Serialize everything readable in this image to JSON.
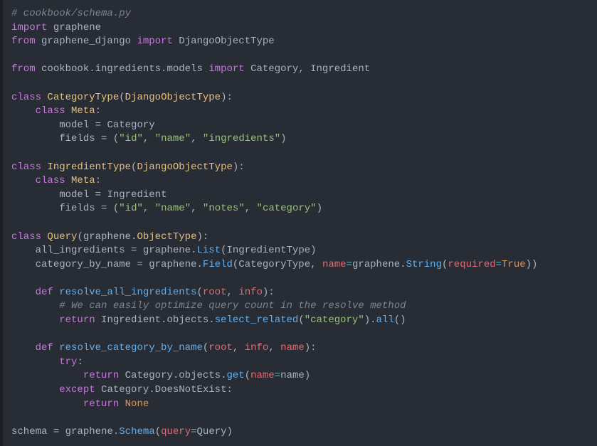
{
  "code": {
    "l1_comment": "# cookbook/schema.py",
    "l2_import": "import",
    "l2_graphene": "graphene",
    "l3_from": "from",
    "l3_mod": "graphene_django",
    "l3_import": "import",
    "l3_type": "DjangoObjectType",
    "l4_from": "from",
    "l4_mod": "cookbook.ingredients.models",
    "l4_import": "import",
    "l4_cat": "Category",
    "l4_comma": ",",
    "l4_ing": "Ingredient",
    "l5_class": "class",
    "l5_name": "CategoryType",
    "l5_open": "(",
    "l5_base": "DjangoObjectType",
    "l5_close": "):",
    "l6_class": "class",
    "l6_meta": "Meta",
    "l6_colon": ":",
    "l7_model": "model",
    "l7_eq": " = ",
    "l7_val": "Category",
    "l8_fields": "fields",
    "l8_eq": " = ",
    "l8_open": "(",
    "l8_s1": "\"id\"",
    "l8_c1": ", ",
    "l8_s2": "\"name\"",
    "l8_c2": ", ",
    "l8_s3": "\"ingredients\"",
    "l8_close": ")",
    "l9_class": "class",
    "l9_name": "IngredientType",
    "l9_open": "(",
    "l9_base": "DjangoObjectType",
    "l9_close": "):",
    "l10_class": "class",
    "l10_meta": "Meta",
    "l10_colon": ":",
    "l11_model": "model",
    "l11_eq": " = ",
    "l11_val": "Ingredient",
    "l12_fields": "fields",
    "l12_eq": " = ",
    "l12_open": "(",
    "l12_s1": "\"id\"",
    "l12_c1": ", ",
    "l12_s2": "\"name\"",
    "l12_c2": ", ",
    "l12_s3": "\"notes\"",
    "l12_c3": ", ",
    "l12_s4": "\"category\"",
    "l12_close": ")",
    "l13_class": "class",
    "l13_name": "Query",
    "l13_open": "(",
    "l13_graphene": "graphene",
    "l13_dot": ".",
    "l13_ot": "ObjectType",
    "l13_close": "):",
    "l14_var": "all_ingredients",
    "l14_eq": " = ",
    "l14_graphene": "graphene",
    "l14_dot": ".",
    "l14_list": "List",
    "l14_open": "(",
    "l14_type": "IngredientType",
    "l14_close": ")",
    "l15_var": "category_by_name",
    "l15_eq": " = ",
    "l15_graphene": "graphene",
    "l15_dot": ".",
    "l15_field": "Field",
    "l15_open": "(",
    "l15_type": "CategoryType",
    "l15_c1": ", ",
    "l15_name_kw": "name",
    "l15_eq2": "=",
    "l15_graphene2": "graphene",
    "l15_dot2": ".",
    "l15_string": "String",
    "l15_open2": "(",
    "l15_req": "required",
    "l15_eq3": "=",
    "l15_true": "True",
    "l15_close2": "))",
    "l16_def": "def",
    "l16_fn": "resolve_all_ingredients",
    "l16_open": "(",
    "l16_root": "root",
    "l16_c1": ", ",
    "l16_info": "info",
    "l16_close": "):",
    "l17_comment": "# We can easily optimize query count in the resolve method",
    "l18_return": "return",
    "l18_ing": "Ingredient",
    "l18_dot1": ".",
    "l18_obj": "objects",
    "l18_dot2": ".",
    "l18_sel": "select_related",
    "l18_open": "(",
    "l18_str": "\"category\"",
    "l18_close": ")",
    "l18_dot3": ".",
    "l18_all": "all",
    "l18_parens": "()",
    "l19_def": "def",
    "l19_fn": "resolve_category_by_name",
    "l19_open": "(",
    "l19_root": "root",
    "l19_c1": ", ",
    "l19_info": "info",
    "l19_c2": ", ",
    "l19_name": "name",
    "l19_close": "):",
    "l20_try": "try",
    "l20_colon": ":",
    "l21_return": "return",
    "l21_cat": "Category",
    "l21_dot1": ".",
    "l21_obj": "objects",
    "l21_dot2": ".",
    "l21_get": "get",
    "l21_open": "(",
    "l21_name_kw": "name",
    "l21_eq": "=",
    "l21_name": "name",
    "l21_close": ")",
    "l22_except": "except",
    "l22_cat": "Category",
    "l22_dot": ".",
    "l22_dne": "DoesNotExist",
    "l22_colon": ":",
    "l23_return": "return",
    "l23_none": "None",
    "l24_schema": "schema",
    "l24_eq": " = ",
    "l24_graphene": "graphene",
    "l24_dot": ".",
    "l24_Schema": "Schema",
    "l24_open": "(",
    "l24_query_kw": "query",
    "l24_eq2": "=",
    "l24_Query": "Query",
    "l24_close": ")"
  }
}
